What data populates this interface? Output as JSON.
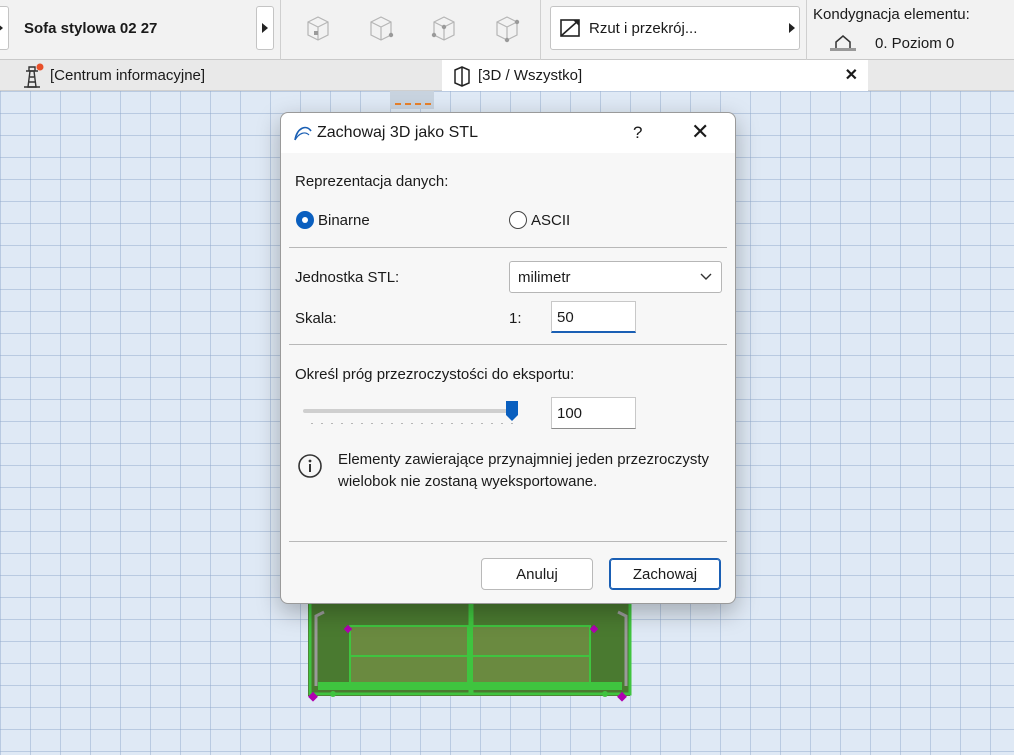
{
  "toolbar": {
    "element_name": "Sofa stylowa 02 27",
    "view_mode_label": "Rzut i przekrój...",
    "story_title": "Kondygnacja elementu:",
    "story_value": "0. Poziom 0"
  },
  "tabs": {
    "info_tab": "[Centrum informacyjne]",
    "view3d_tab": "[3D / Wszystko]",
    "close_symbol": "✕"
  },
  "dialog": {
    "title": "Zachowaj 3D jako STL",
    "help_symbol": "?",
    "close_symbol": "✕",
    "data_representation_label": "Reprezentacja danych:",
    "radio_binary": "Binarne",
    "radio_ascii": "ASCII",
    "selected_representation": "Binarne",
    "unit_label": "Jednostka STL:",
    "unit_value": "milimetr",
    "scale_label": "Skala:",
    "scale_prefix": "1:",
    "scale_value": "50",
    "transparency_label": "Określ próg przezroczystości do eksportu:",
    "transparency_slider_fraction": 1.0,
    "transparency_value": "100",
    "info_text": "Elementy zawierające przynajmniej jeden przezroczysty wielobok nie zostaną wyeksportowane.",
    "cancel_label": "Anuluj",
    "save_label": "Zachowaj"
  },
  "colors": {
    "accent": "#1a5fb4",
    "model_green": "#3fc43f",
    "model_brown": "#5a4a2a",
    "hotspot_purple": "#b000b0",
    "notification_dot": "#e8502a"
  },
  "icons": [
    "arrow-right-icon",
    "view-3d-cube-icon",
    "plan-section-icon",
    "story-level-icon",
    "info-center-lighthouse-icon",
    "view-3d-tab-icon",
    "archicad-logo-icon",
    "chevron-down-icon",
    "info-icon"
  ]
}
